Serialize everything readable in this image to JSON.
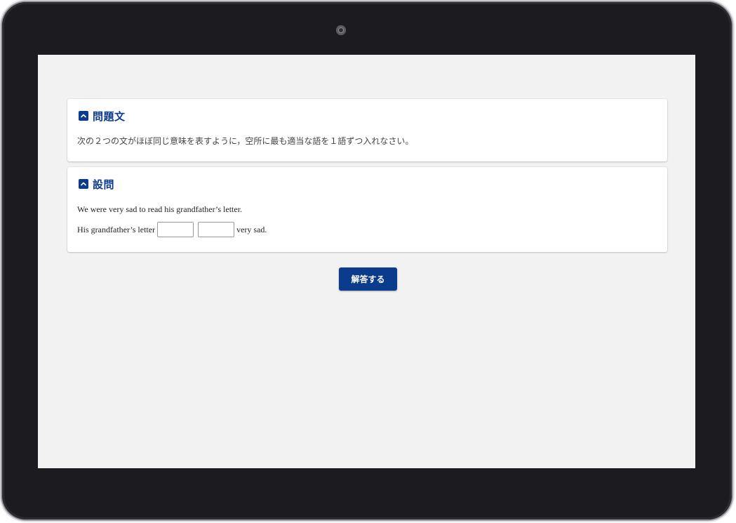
{
  "question_card": {
    "title": "問題文",
    "instruction": "次の２つの文がほぼ同じ意味を表すように，空所に最も適当な語を１語ずつ入れなさい。"
  },
  "setsumon_card": {
    "title": "設問",
    "sentence_1": "We were very sad to read his grandfather’s letter.",
    "sentence_2_prefix": "His grandfather’s letter",
    "sentence_2_suffix": "very sad.",
    "blank_1_value": "",
    "blank_2_value": ""
  },
  "answer_button_label": "解答する",
  "icons": {
    "section_toggle": "chevron-up-icon",
    "camera": "front-camera-icon"
  },
  "colors": {
    "accent": "#0b3b8c",
    "screen_background": "#f3f2f2",
    "card_background": "#ffffff",
    "bezel": "#1c1c20"
  }
}
